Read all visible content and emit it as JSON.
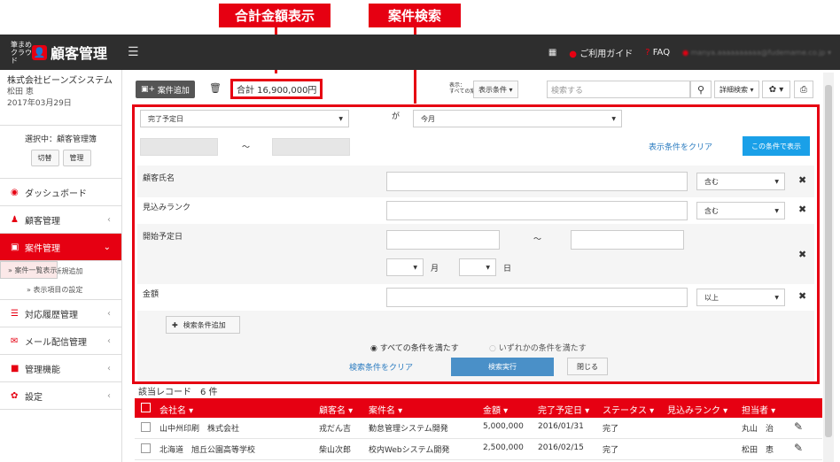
{
  "callouts": {
    "total": "合計金額表示",
    "search": "案件検索"
  },
  "topbar": {
    "logo_small": "筆まめクラウド",
    "logo_title": "顧客管理",
    "guide": "ご利用ガイド",
    "faq": "FAQ",
    "user": "manya.aaaaaaaaaa@fudemame.co.jp"
  },
  "sidebar": {
    "company": "株式会社ビーンズシステム",
    "user": "松田 恵",
    "date": "2017年03月29日",
    "selecting": "選択中：顧客管理簿",
    "switch": "切替",
    "manage": "管理",
    "nav": [
      {
        "label": "ダッシュボード",
        "icon": "dashboard-icon"
      },
      {
        "label": "顧客管理",
        "icon": "users-icon"
      },
      {
        "label": "案件管理",
        "icon": "project-icon"
      }
    ],
    "subs": [
      "» 案件一覧表示",
      "» 案件の新規追加",
      "» 表示項目の設定"
    ],
    "nav2": [
      {
        "label": "対応履歴管理"
      },
      {
        "label": "メール配信管理"
      },
      {
        "label": "管理機能"
      },
      {
        "label": "設定"
      }
    ]
  },
  "toolbar": {
    "add": "案件追加",
    "total": "合計 16,900,000円",
    "disp_small": "表示：\nすべての案件",
    "disp_cond": "表示条件 ▾",
    "search_placeholder": "検索する",
    "detail": "詳細検索 ▾"
  },
  "panel": {
    "field": "完了予定日",
    "ga": "が",
    "value": "今月",
    "tilde": "〜",
    "clear_display": "表示条件をクリア",
    "show_btn": "この条件で表示",
    "rows": [
      {
        "label": "顧客氏名",
        "op": "含む"
      },
      {
        "label": "見込みランク",
        "op": "含む"
      },
      {
        "label": "開始予定日",
        "month": "月",
        "day": "日",
        "tilde": "〜"
      },
      {
        "label": "金額",
        "op": "以上"
      }
    ],
    "add_cond": "検索条件追加",
    "all": "すべての条件を満たす",
    "any": "いずれかの条件を満たす",
    "clear_search": "検索条件をクリア",
    "exec": "検索実行",
    "close": "閉じる"
  },
  "result": "該当レコード　6 件",
  "table": {
    "headers": [
      "会社名 ▾",
      "顧客名 ▾",
      "案件名 ▾",
      "金額 ▾",
      "完了予定日 ▾",
      "ステータス ▾",
      "見込みランク ▾",
      "担当者 ▾"
    ],
    "rows": [
      [
        "山中州印刷　株式会社",
        "戎だん吉",
        "勤怠管理システム開発",
        "5,000,000",
        "2016/01/31",
        "完了",
        "",
        "丸山　治"
      ],
      [
        "北海道　旭丘公園高等学校",
        "柴山次郎",
        "校内Webシステム開発",
        "2,500,000",
        "2016/02/15",
        "完了",
        "",
        "松田　恵"
      ]
    ]
  }
}
